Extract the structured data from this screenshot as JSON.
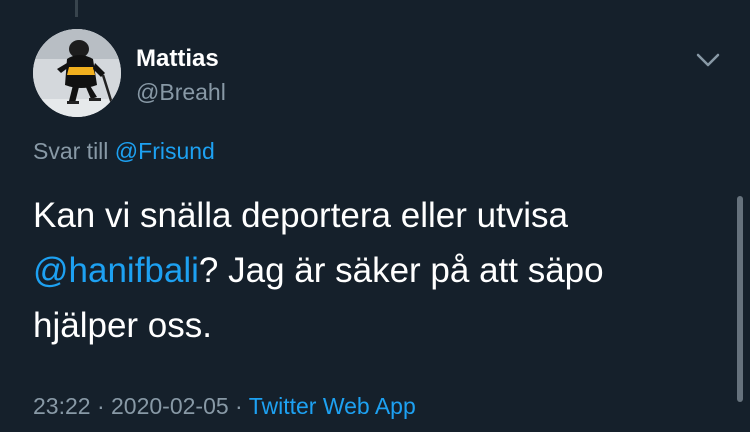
{
  "tweet": {
    "display_name": "Mattias",
    "handle": "@Breahl",
    "reply_prefix": "Svar till",
    "reply_to": "@Frisund",
    "text_part1": "Kan vi snälla deportera eller utvisa",
    "mention": "@hanifbali",
    "text_part2": "? Jag är säker på att säpo hjälper oss.",
    "time": "23:22",
    "separator": " · ",
    "date": "2020-02-05",
    "source": "Twitter Web App"
  },
  "colors": {
    "background": "#15202b",
    "text_primary": "#ffffff",
    "text_secondary": "#8899a6",
    "link": "#1da1f2"
  },
  "icons": {
    "caret": "chevron-down-icon",
    "avatar": "hockey-player-avatar"
  }
}
